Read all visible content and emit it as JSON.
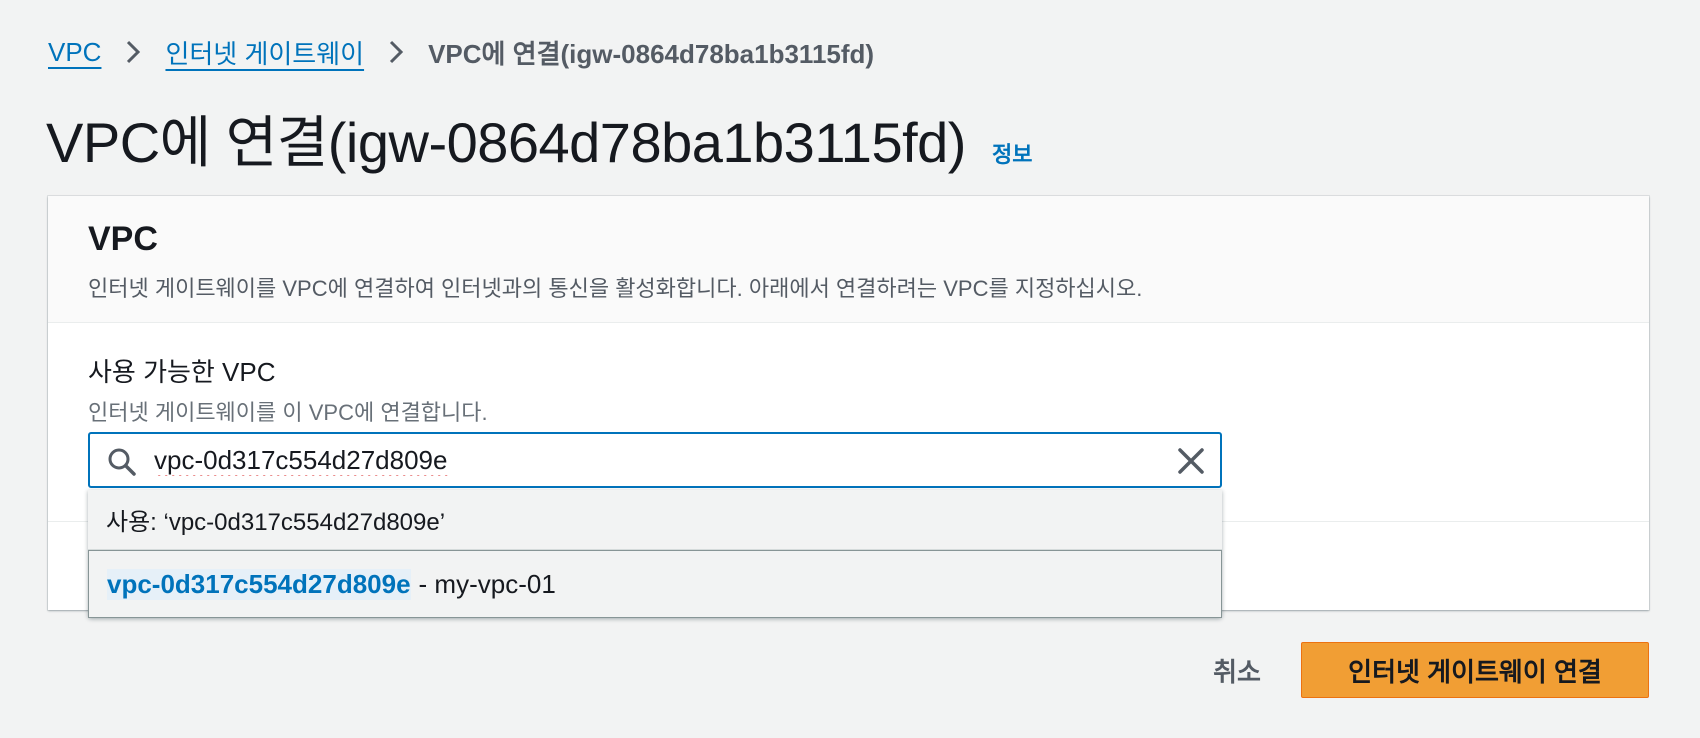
{
  "breadcrumb": {
    "items": [
      {
        "label": "VPC"
      },
      {
        "label": "인터넷 게이트웨이"
      }
    ],
    "current": "VPC에 연결(igw-0864d78ba1b3115fd)"
  },
  "page": {
    "title": "VPC에 연결(igw-0864d78ba1b3115fd)",
    "info_link": "정보"
  },
  "panel": {
    "title": "VPC",
    "description": "인터넷 게이트웨이를 VPC에 연결하여 인터넷과의 통신을 활성화합니다. 아래에서 연결하려는 VPC를 지정하십시오."
  },
  "field": {
    "label": "사용 가능한 VPC",
    "description": "인터넷 게이트웨이를 이 VPC에 연결합니다.",
    "value": "vpc-0d317c554d27d809e"
  },
  "dropdown": {
    "use_text": "사용: ‘vpc-0d317c554d27d809e’",
    "options": [
      {
        "id": "vpc-0d317c554d27d809e",
        "name": "- my-vpc-01"
      }
    ]
  },
  "actions": {
    "cancel_label": "취소",
    "submit_label": "인터넷 게이트웨이 연결"
  },
  "colors": {
    "link": "#0073bb",
    "primary_button": "#f19e34",
    "background": "#f2f3f3"
  },
  "icons": [
    "chevron-right-icon",
    "search-icon",
    "close-icon"
  ]
}
